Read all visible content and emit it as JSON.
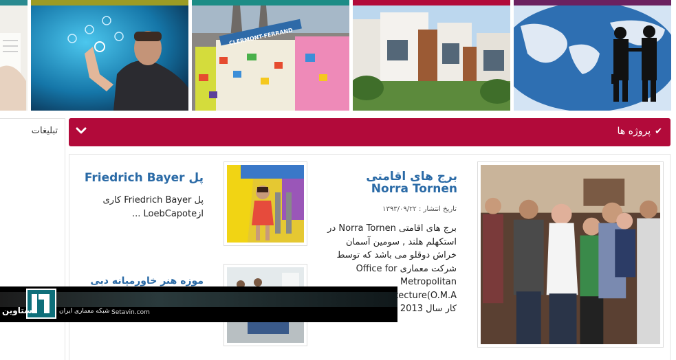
{
  "banner": {
    "tiles": [
      {
        "name": "banner-tile-documents",
        "stripe": "#2a8a90"
      },
      {
        "name": "banner-tile-technology",
        "stripe": "#9c9b24"
      },
      {
        "name": "banner-tile-clermont",
        "stripe": "#1c8c86"
      },
      {
        "name": "banner-tile-villa",
        "stripe": "#b20a3a"
      },
      {
        "name": "banner-tile-business",
        "stripe": "#6b2160"
      }
    ],
    "clermont_sign": "CLERMONT-FERRAND"
  },
  "sidebar": {
    "ads_title": "تبلیغات"
  },
  "section": {
    "title": "پروژه ها",
    "icon": "check-icon",
    "toggle_icon": "chevron-down-icon"
  },
  "projects": [
    {
      "title": "برج های اقامتی Norra Tornen",
      "date": "تاریخ انتشار : ۱۳۹۳/۰۹/۲۲",
      "excerpt": "برج های اقامتی Norra Tornen در استکهلم هلند , سومین آسمان خراش دوقلو می باشد که توسط شرکت معماری Office for Metropolitan Architecture(O.M.A شده است . کار سال 2013 ..."
    },
    {
      "title": "پل Friedrich Bayer",
      "excerpt": "پل Friedrich Bayer کاری ازLoebCapote ..."
    },
    {
      "title": "موزه هنر خاورمیانه دبی"
    }
  ],
  "watermark": {
    "brand": "ستاوین",
    "tagline": "شبکه معماری ایران",
    "site": "Setavin.com"
  }
}
